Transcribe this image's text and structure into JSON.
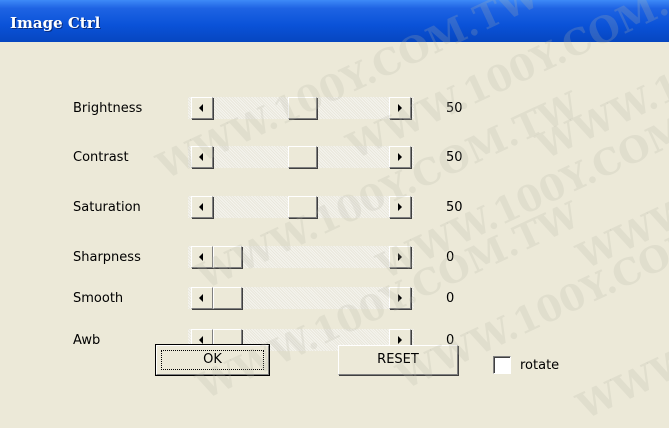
{
  "window": {
    "title": "Image Ctrl"
  },
  "sliders": [
    {
      "label": "Brightness",
      "value": "50",
      "level": 0.5
    },
    {
      "label": "Contrast",
      "value": "50",
      "level": 0.5
    },
    {
      "label": "Saturation",
      "value": "50",
      "level": 0.5
    },
    {
      "label": "Sharpness",
      "value": "0",
      "level": 0.0
    },
    {
      "label": "Smooth",
      "value": "0",
      "level": 0.0
    },
    {
      "label": "Awb",
      "value": "0",
      "level": 0.0
    }
  ],
  "buttons": {
    "ok": "OK",
    "reset": "RESET"
  },
  "rotate": {
    "label": "rotate",
    "checked": false
  },
  "watermark": "WWW.100Y.COM.TW",
  "colors": {
    "titlebar": "#0a52d8",
    "face": "#ece9d8"
  }
}
